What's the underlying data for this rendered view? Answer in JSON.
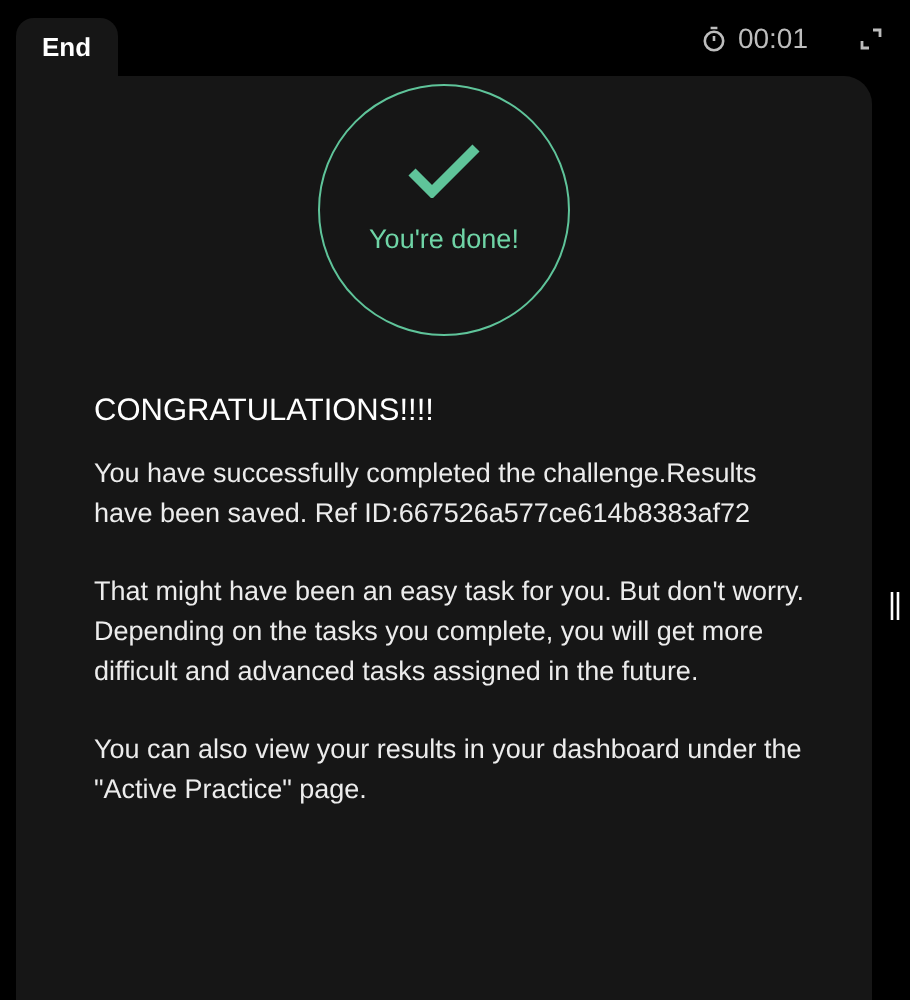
{
  "tab": {
    "label": "End",
    "selected": true
  },
  "timer": "00:01",
  "status": {
    "done": true,
    "label": "You're done!"
  },
  "heading": "CONGRATULATIONS!!!!",
  "paragraphs": [
    "You have successfully completed the challenge.Results have been saved. Ref ID:667526a577ce614b8383af72",
    "That might have been an easy task for you. But don't worry. Depending on the tasks you complete, you will get more difficult and advanced tasks assigned in the future.",
    "You can also view your results in your dashboard under the \"Active Practice\" page."
  ]
}
